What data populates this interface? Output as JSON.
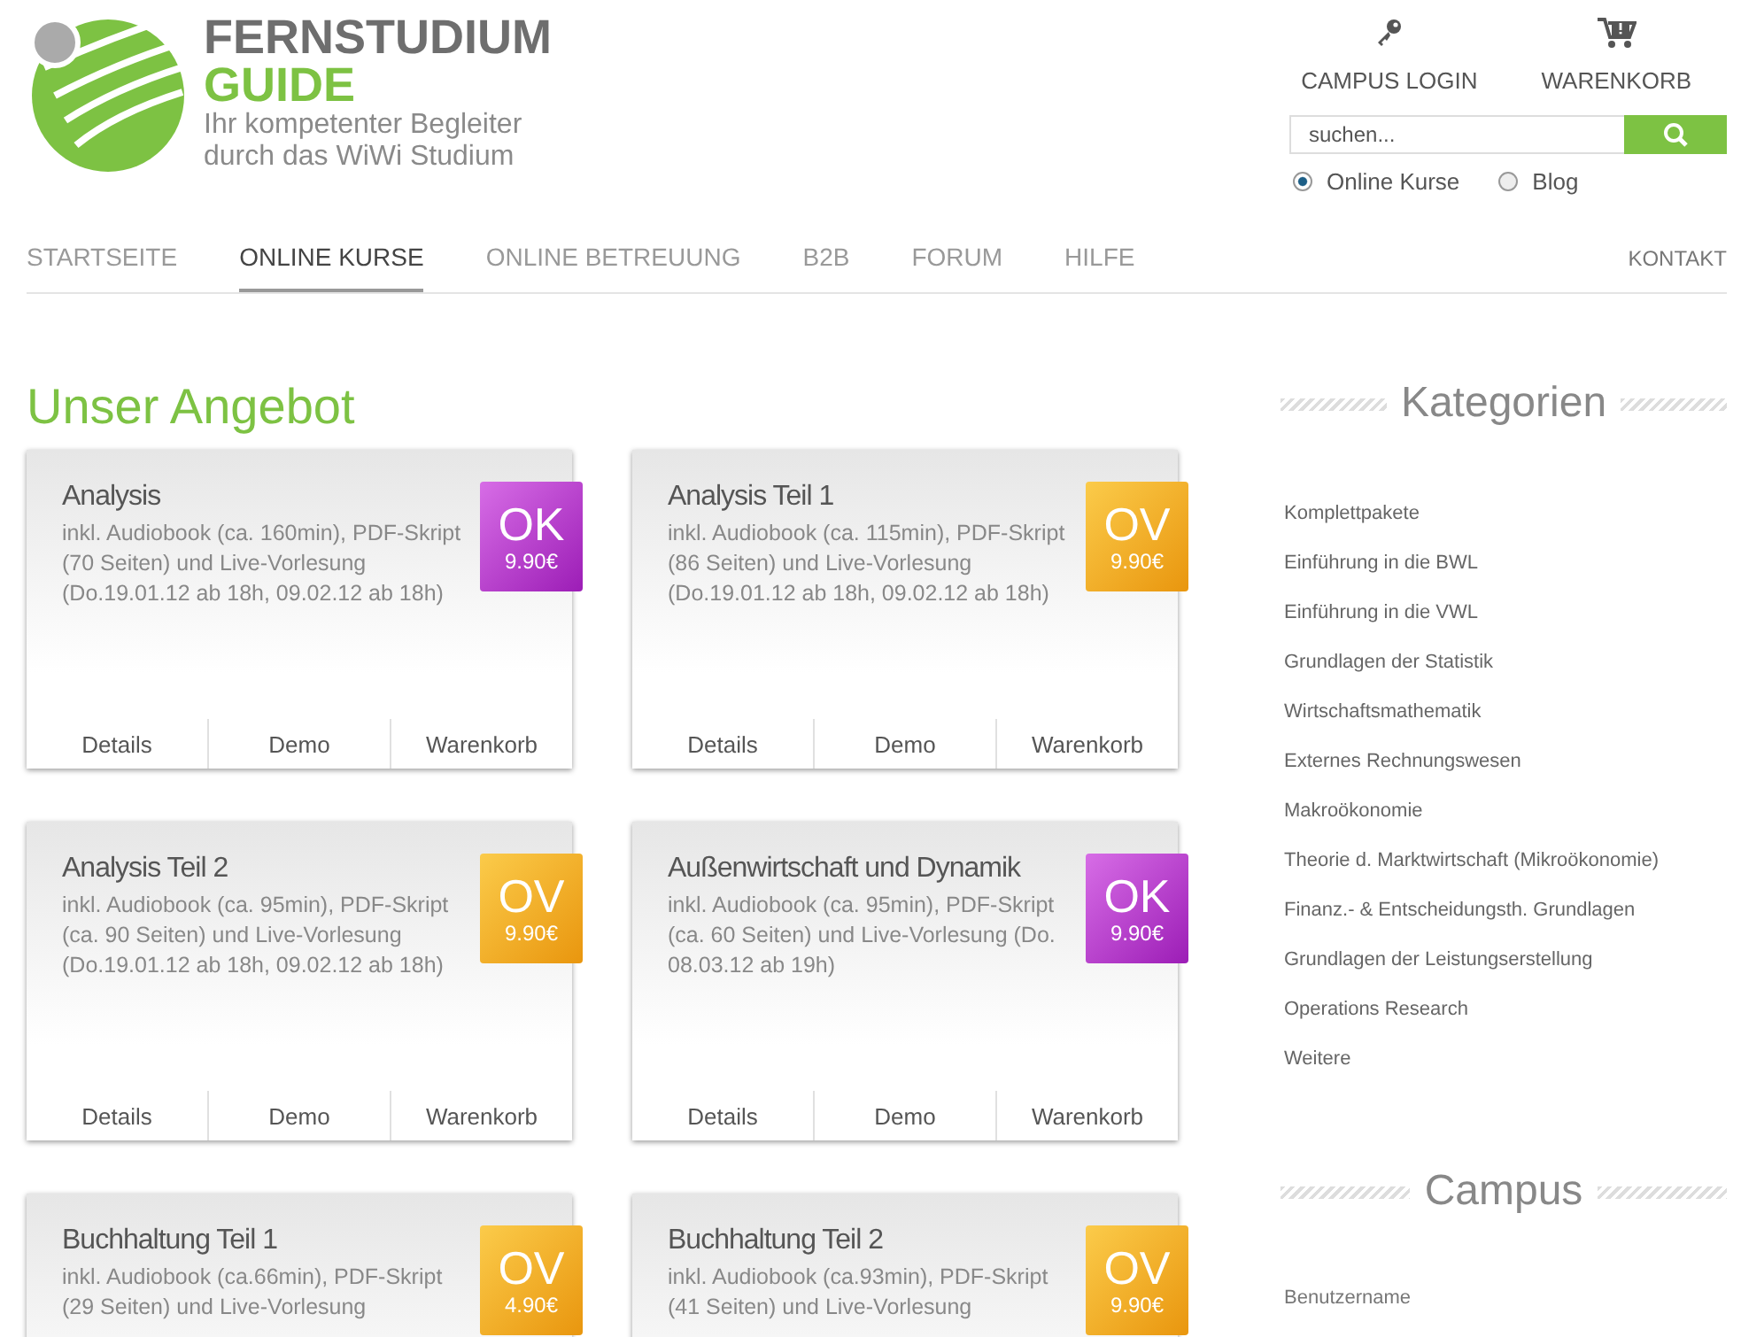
{
  "brand": {
    "name": "FERNSTUDIUM",
    "sub": "GUIDE",
    "tagline": "Ihr kompetenter Begleiter durch das WiWi Studium"
  },
  "header_links": [
    {
      "kind": "key",
      "label": "CAMPUS LOGIN"
    },
    {
      "kind": "cart",
      "label": "WARENKORB"
    }
  ],
  "search": {
    "placeholder": "suchen..."
  },
  "search_scope": [
    {
      "label": "Online Kurse",
      "selected": true
    },
    {
      "label": "Blog",
      "selected": false
    }
  ],
  "nav": [
    {
      "label": "STARTSEITE",
      "selected": false
    },
    {
      "label": "ONLINE KURSE",
      "selected": true
    },
    {
      "label": "ONLINE BETREUUNG",
      "selected": false
    },
    {
      "label": "B2B",
      "selected": false
    },
    {
      "label": "FORUM",
      "selected": false
    },
    {
      "label": "HILFE",
      "selected": false
    }
  ],
  "nav_right": "KONTAKT",
  "heading": "Unser Angebot",
  "courses": [
    {
      "title": "Analysis",
      "description": "inkl. Audiobook (ca. 160min), PDF-Skript (70 Seiten) und Live-Vorlesung (Do.19.01.12 ab 18h, 09.02.12 ab 18h)",
      "badge": {
        "kind": "ok",
        "label": "OK",
        "price": "9.90€"
      },
      "actions": [
        "Details",
        "Demo",
        "Warenkorb"
      ]
    },
    {
      "title": "Analysis Teil 1",
      "description": "inkl. Audiobook (ca. 115min), PDF-Skript (86 Seiten) und Live-Vorlesung (Do.19.01.12 ab 18h, 09.02.12 ab 18h)",
      "badge": {
        "kind": "ov",
        "label": "OV",
        "price": "9.90€"
      },
      "actions": [
        "Details",
        "Demo",
        "Warenkorb"
      ]
    },
    {
      "title": "Analysis Teil 2",
      "description": "inkl. Audiobook (ca. 95min), PDF-Skript (ca. 90 Seiten) und Live-Vorlesung (Do.19.01.12 ab 18h, 09.02.12 ab 18h)",
      "badge": {
        "kind": "ov",
        "label": "OV",
        "price": "9.90€"
      },
      "actions": [
        "Details",
        "Demo",
        "Warenkorb"
      ]
    },
    {
      "title": "Außenwirtschaft und Dynamik",
      "description": "inkl. Audiobook (ca. 95min), PDF-Skript (ca. 60 Seiten) und Live-Vorlesung (Do. 08.03.12 ab 19h)",
      "badge": {
        "kind": "ok",
        "label": "OK",
        "price": "9.90€"
      },
      "actions": [
        "Details",
        "Demo",
        "Warenkorb"
      ]
    },
    {
      "title": "Buchhaltung Teil 1",
      "description": "inkl. Audiobook (ca.66min), PDF-Skript (29 Seiten) und Live-Vorlesung",
      "badge": {
        "kind": "ov",
        "label": "OV",
        "price": "4.90€"
      }
    },
    {
      "title": "Buchhaltung Teil 2",
      "description": "inkl. Audiobook (ca.93min), PDF-Skript (41 Seiten) und Live-Vorlesung",
      "badge": {
        "kind": "ov",
        "label": "OV",
        "price": "9.90€"
      }
    }
  ],
  "sidebar": {
    "categories_title": "Kategorien",
    "categories": [
      "Komplettpakete",
      "Einführung in die BWL",
      "Einführung in die VWL",
      "Grundlagen der Statistik",
      "Wirtschaftsmathematik",
      "Externes Rechnungswesen",
      "Makroökonomie",
      "Theorie d. Marktwirtschaft (Mikroökonomie)",
      "Finanz.- & Entscheidungsth. Grundlagen",
      "Grundlagen der Leistungserstellung",
      "Operations Research",
      "Weitere"
    ],
    "campus_title": "Campus",
    "campus_fields": [
      "Benutzername"
    ]
  }
}
